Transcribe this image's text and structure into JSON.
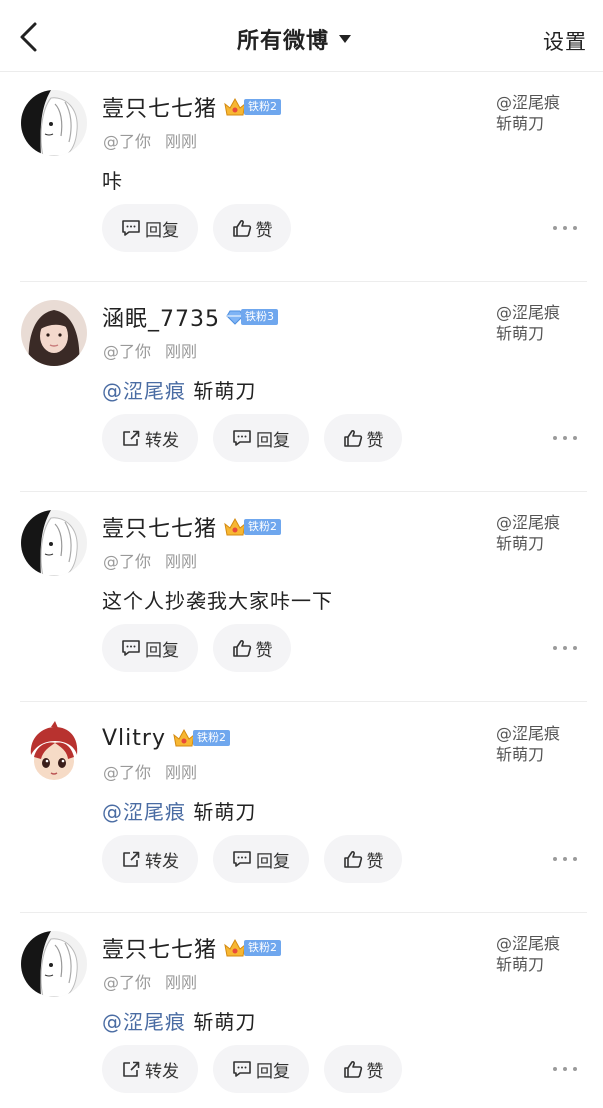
{
  "header": {
    "title": "所有微博",
    "settings_label": "设置"
  },
  "actions": {
    "repost": "转发",
    "reply": "回复",
    "like": "赞"
  },
  "comments": [
    {
      "username": "壹只七七猪",
      "badge": "铁粉2",
      "meta_at": "@了你",
      "meta_time": "刚刚",
      "target_line1": "@涩尾痕",
      "target_line2": "斩萌刀",
      "text": "咔",
      "mention": "",
      "rest": ""
    },
    {
      "username": "涵眠_7735",
      "badge": "铁粉3",
      "meta_at": "@了你",
      "meta_time": "刚刚",
      "target_line1": "@涩尾痕",
      "target_line2": "斩萌刀",
      "text": "",
      "mention": "@涩尾痕",
      "rest": "斩萌刀"
    },
    {
      "username": "壹只七七猪",
      "badge": "铁粉2",
      "meta_at": "@了你",
      "meta_time": "刚刚",
      "target_line1": "@涩尾痕",
      "target_line2": "斩萌刀",
      "text": "这个人抄袭我大家咔一下",
      "mention": "",
      "rest": ""
    },
    {
      "username": "Vlitry",
      "badge": "铁粉2",
      "meta_at": "@了你",
      "meta_time": "刚刚",
      "target_line1": "@涩尾痕",
      "target_line2": "斩萌刀",
      "text": "",
      "mention": "@涩尾痕",
      "rest": "斩萌刀"
    },
    {
      "username": "壹只七七猪",
      "badge": "铁粉2",
      "meta_at": "@了你",
      "meta_time": "刚刚",
      "target_line1": "@涩尾痕",
      "target_line2": "斩萌刀",
      "text": "",
      "mention": "@涩尾痕",
      "rest": "斩萌刀"
    }
  ],
  "colors": {
    "mention": "#4a6ca3",
    "badge": "#6fa7ee",
    "button_bg": "#f4f4f6"
  },
  "icons": {
    "back": "chevron-left-icon",
    "dropdown": "caret-down-icon",
    "repost": "share-icon",
    "reply": "comment-icon",
    "like": "thumbs-up-icon",
    "more": "more-dots-icon"
  }
}
